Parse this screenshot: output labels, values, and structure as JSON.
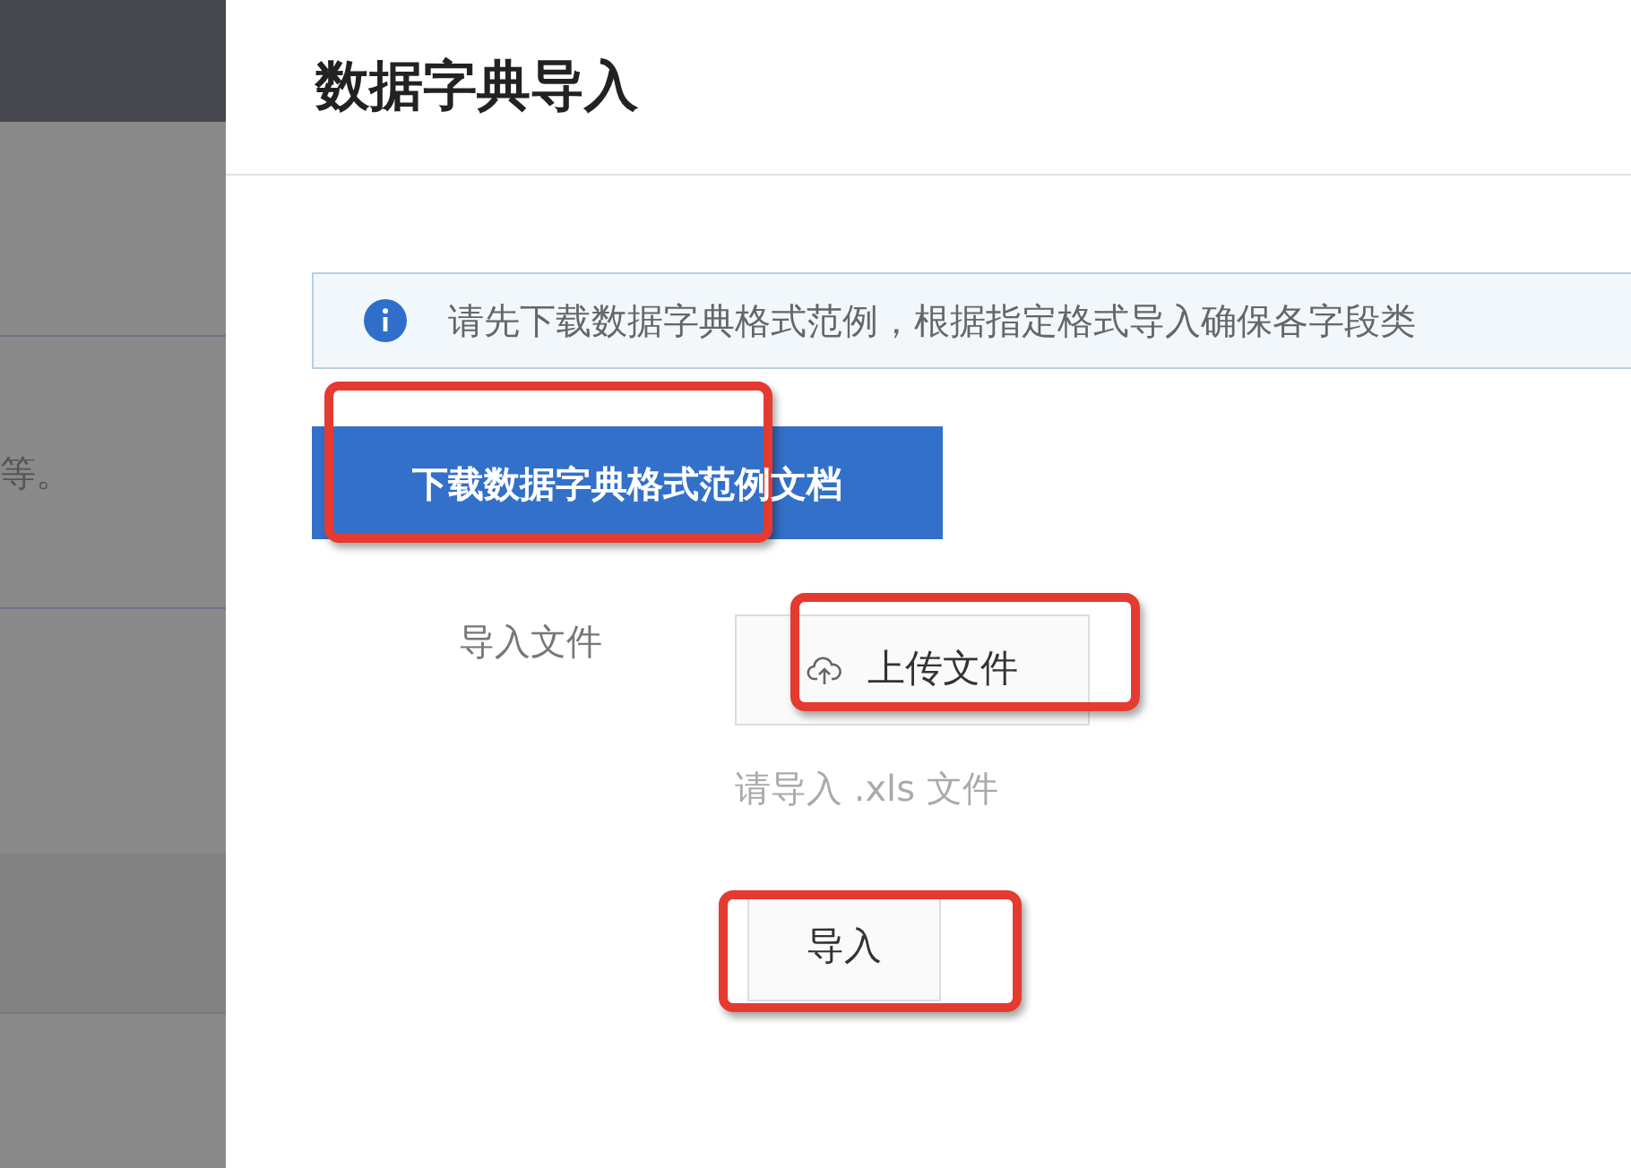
{
  "background": {
    "text": "等。"
  },
  "drawer": {
    "title": "数据字典导入",
    "notice": "请先下载数据字典格式范例，根据指定格式导入确保各字段类",
    "download_button": "下载数据字典格式范例文档",
    "form": {
      "label": "导入文件",
      "upload_button": "上传文件",
      "hint": "请导入 .xls 文件"
    },
    "submit_button": "导入"
  }
}
